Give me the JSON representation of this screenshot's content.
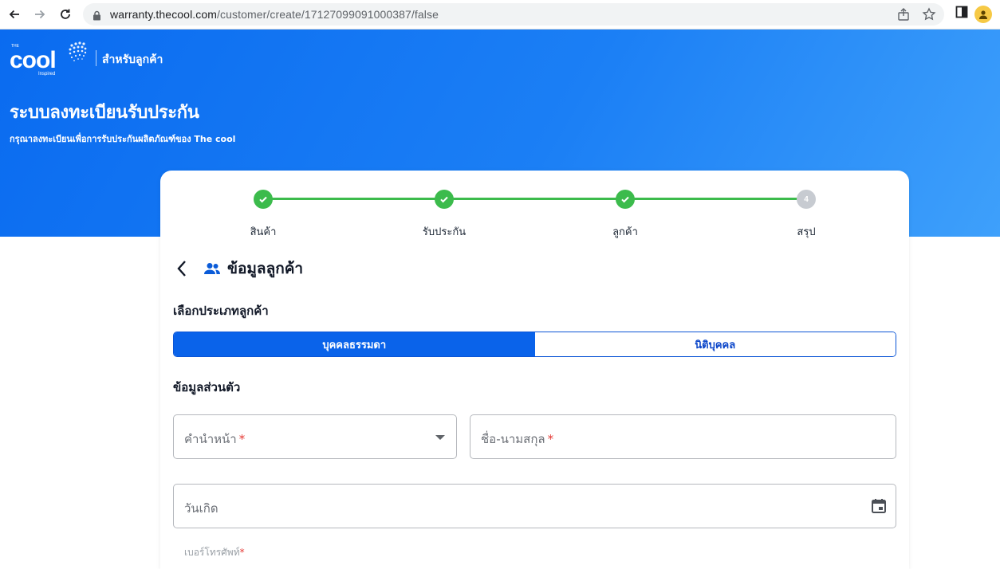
{
  "browser": {
    "url_host": "warranty.thecool.com",
    "url_path": "/customer/create/17127099091000387/false"
  },
  "hero": {
    "logo_word": "cool",
    "logo_the": "THE",
    "logo_inspired": "Inspired",
    "caption": "สำหรับลูกค้า",
    "title": "ระบบลงทะเบียนรับประกัน",
    "subtitle": "กรุณาลงทะเบียนเพื่อการรับประกันผลิตภัณฑ์ของ The cool"
  },
  "stepper": {
    "steps": [
      {
        "label": "สินค้า",
        "status": "done"
      },
      {
        "label": "รับประกัน",
        "status": "done"
      },
      {
        "label": "ลูกค้า",
        "status": "done"
      },
      {
        "label": "สรุป",
        "status": "pending",
        "number": "4"
      }
    ],
    "progress_color": "#3cbb4c"
  },
  "section": {
    "title": "ข้อมูลลูกค้า",
    "customer_type_label": "เลือกประเภทลูกค้า",
    "types": [
      {
        "label": "บุคคลธรรมดา",
        "selected": true
      },
      {
        "label": "นิติบุคคล",
        "selected": false
      }
    ],
    "personal_info_label": "ข้อมูลส่วนตัว"
  },
  "form": {
    "prefix_placeholder": "คำนำหน้า",
    "name_placeholder": "ชื่อ-นามสกุล",
    "birthdate_placeholder": "วันเกิด",
    "phone_placeholder": "เบอร์โทรศัพท์",
    "required_mark": "*"
  },
  "colors": {
    "brand_blue": "#0a6bf0",
    "selected_segment": "#0a63ea",
    "required": "#e53935"
  }
}
